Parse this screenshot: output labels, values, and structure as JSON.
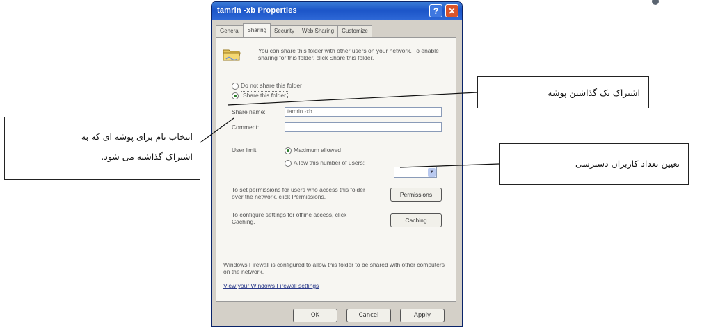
{
  "dialog": {
    "title": "tamrin -xb Properties",
    "help_label": "?",
    "close_label": "✕",
    "tabs": [
      "General",
      "Sharing",
      "Security",
      "Web Sharing",
      "Customize"
    ],
    "active_tab": "Sharing",
    "intro_text": "You can share this folder with other users on your network. To enable sharing for this folder, click Share this folder.",
    "option_do_not_share": "Do not share this folder",
    "option_share": "Share this folder",
    "share_name_label": "Share name:",
    "share_name_value": "tamrin -xb",
    "comment_label": "Comment:",
    "comment_value": "",
    "user_limit_label": "User limit:",
    "limit_maximum": "Maximum allowed",
    "limit_allow": "Allow this number of users:",
    "permissions_text": "To set permissions for users who access this folder over the network, click Permissions.",
    "permissions_button": "Permissions",
    "caching_text": "To configure settings for offline access, click Caching.",
    "caching_button": "Caching",
    "firewall_text": "Windows Firewall is configured to allow this folder to be shared with other computers on the network.",
    "firewall_link": "View your Windows Firewall settings",
    "ok_button": "OK",
    "cancel_button": "Cancel",
    "apply_button": "Apply"
  },
  "callouts": {
    "share_folder": "اشتراک یک گذاشتن پوشه",
    "share_name_line1": "انتخاب نام برای پوشه ای که به",
    "share_name_line2": "اشتراک گذاشته می شود.",
    "user_count": "تعیین تعداد کاربران دسترسی"
  },
  "colors": {
    "title_bar": "#1c55c8",
    "close_button": "#d9542b",
    "dialog_face": "#d4d0c8"
  }
}
